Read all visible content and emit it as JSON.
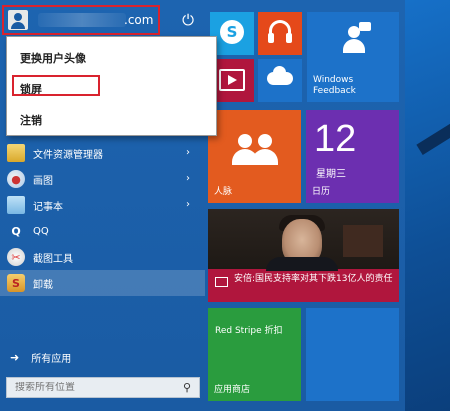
{
  "user": {
    "name_suffix": ".com"
  },
  "power_icon": "⏻",
  "user_menu": {
    "items": [
      "更换用户头像",
      "锁屏",
      "注销"
    ]
  },
  "apps": [
    {
      "label": "文件资源管理器",
      "icon": "folder-icon",
      "has_submenu": true
    },
    {
      "label": "画图",
      "icon": "paint-icon",
      "has_submenu": true
    },
    {
      "label": "记事本",
      "icon": "notepad-icon",
      "has_submenu": true
    },
    {
      "label": "QQ",
      "icon": "qq-icon",
      "has_submenu": false
    },
    {
      "label": "截图工具",
      "icon": "snipping-tool-icon",
      "has_submenu": false
    },
    {
      "label": "卸载",
      "icon": "uninstall-icon",
      "has_submenu": false
    }
  ],
  "all_apps": {
    "label": "所有应用"
  },
  "search": {
    "placeholder": "搜索所有位置"
  },
  "tiles": {
    "feedback": {
      "label_line1": "Windows",
      "label_line2": "Feedback"
    },
    "people": {
      "label": "人脉"
    },
    "calendar": {
      "number": "12",
      "day": "星期三",
      "label": "日历"
    },
    "news": {
      "headline": "安倍:国民支持率对其下跌13亿人的责任"
    },
    "store": {
      "promo": "Red Stripe 折扣",
      "label": "应用商店"
    }
  },
  "colors": {
    "highlight_border": "#d9232e",
    "start_bg": "#1d64b0"
  }
}
